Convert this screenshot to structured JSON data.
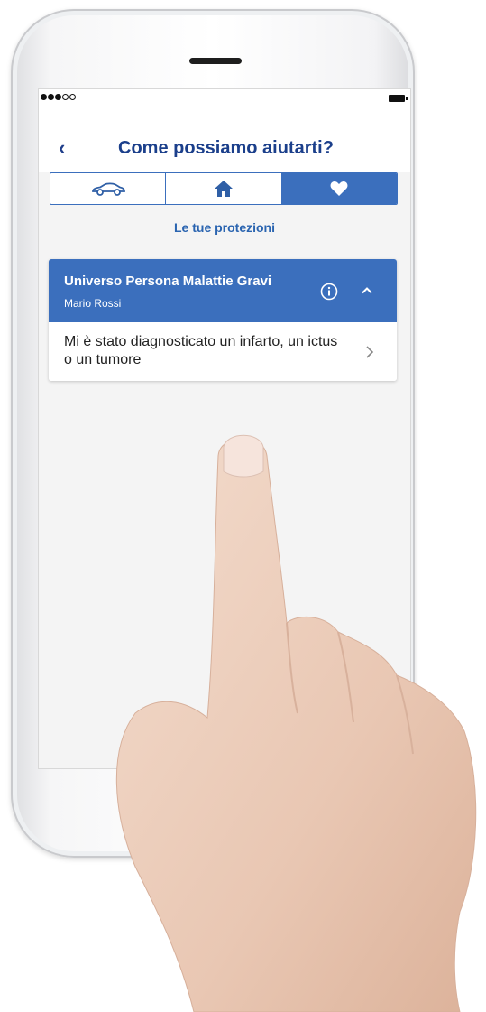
{
  "status_bar": {
    "signal_icon": "signal-dots-icon",
    "battery_icon": "battery-icon"
  },
  "nav": {
    "back_label": "‹",
    "title": "Come possiamo aiutarti?"
  },
  "tabs": [
    {
      "icon": "car-icon",
      "active": false
    },
    {
      "icon": "home-icon",
      "active": false
    },
    {
      "icon": "heart-icon",
      "active": true
    }
  ],
  "section": {
    "title": "Le tue protezioni"
  },
  "policy": {
    "name": "Universo Persona Malattie Gravi",
    "insured": "Mario Rossi",
    "info_icon": "info-icon",
    "toggle_icon": "chevron-up-icon",
    "claims": [
      {
        "text": "Mi è stato diagnosticato un infarto, un ictus o un tumore",
        "icon": "chevron-right-icon"
      }
    ]
  },
  "colors": {
    "brand_blue": "#3b6fbd",
    "title_blue": "#1b3f8b",
    "background": "#f4f4f4"
  }
}
